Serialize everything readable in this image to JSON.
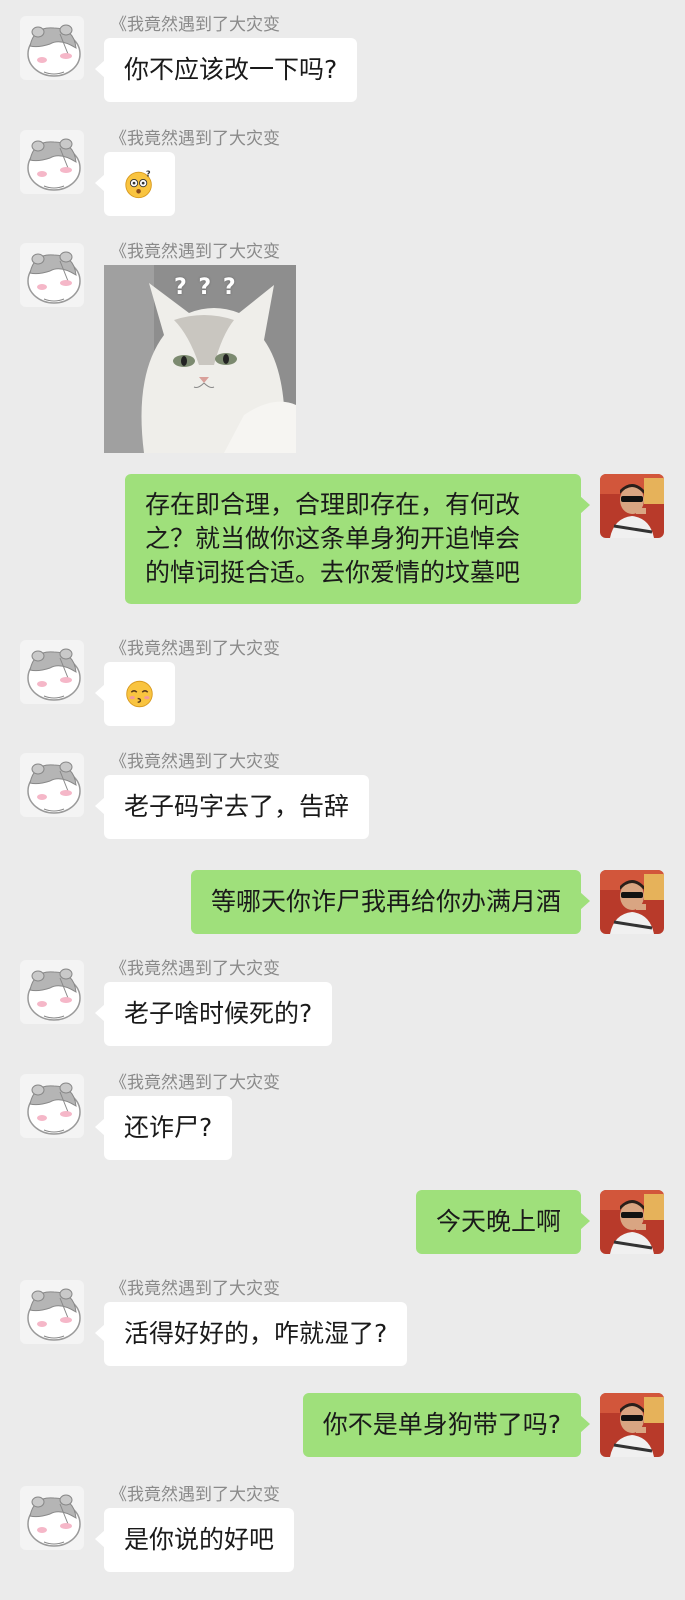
{
  "chat": {
    "friend_name": "《我竟然遇到了大灾变",
    "messages": [
      {
        "from": "friend",
        "kind": "text",
        "text": "你不应该改一下吗?"
      },
      {
        "from": "friend",
        "kind": "emoji",
        "icon": "dizzy-face-question-emoji"
      },
      {
        "from": "friend",
        "kind": "image",
        "icon": "confused-cat-sticker",
        "caption": "? ? ?"
      },
      {
        "from": "me",
        "kind": "text",
        "lines": [
          "存在即合理，合理即存在，有何改",
          "之？就当做你这条单身狗开追悼会",
          "的悼词挺合适。去你爱情的坟墓吧"
        ]
      },
      {
        "from": "friend",
        "kind": "emoji",
        "icon": "kissing-face-closed-eyes-emoji"
      },
      {
        "from": "friend",
        "kind": "text",
        "text": "老子码字去了，告辞"
      },
      {
        "from": "me",
        "kind": "text",
        "text": "等哪天你诈尸我再给你办满月酒"
      },
      {
        "from": "friend",
        "kind": "text",
        "text": "老子啥时候死的?"
      },
      {
        "from": "friend",
        "kind": "text",
        "text": "还诈尸?"
      },
      {
        "from": "me",
        "kind": "text",
        "text": "今天晚上啊"
      },
      {
        "from": "friend",
        "kind": "text",
        "text": "活得好好的，咋就湿了?"
      },
      {
        "from": "me",
        "kind": "text",
        "text": "你不是单身狗带了吗?"
      },
      {
        "from": "friend",
        "kind": "text",
        "text": "是你说的好吧"
      }
    ]
  },
  "colors": {
    "background": "#ebebeb",
    "incoming_bubble": "#ffffff",
    "outgoing_bubble": "#9fe07b",
    "sender_name": "#8a8a8a"
  },
  "icons": {
    "friend_avatar": "hamster-avatar",
    "my_avatar": "person-sunglasses-avatar"
  }
}
